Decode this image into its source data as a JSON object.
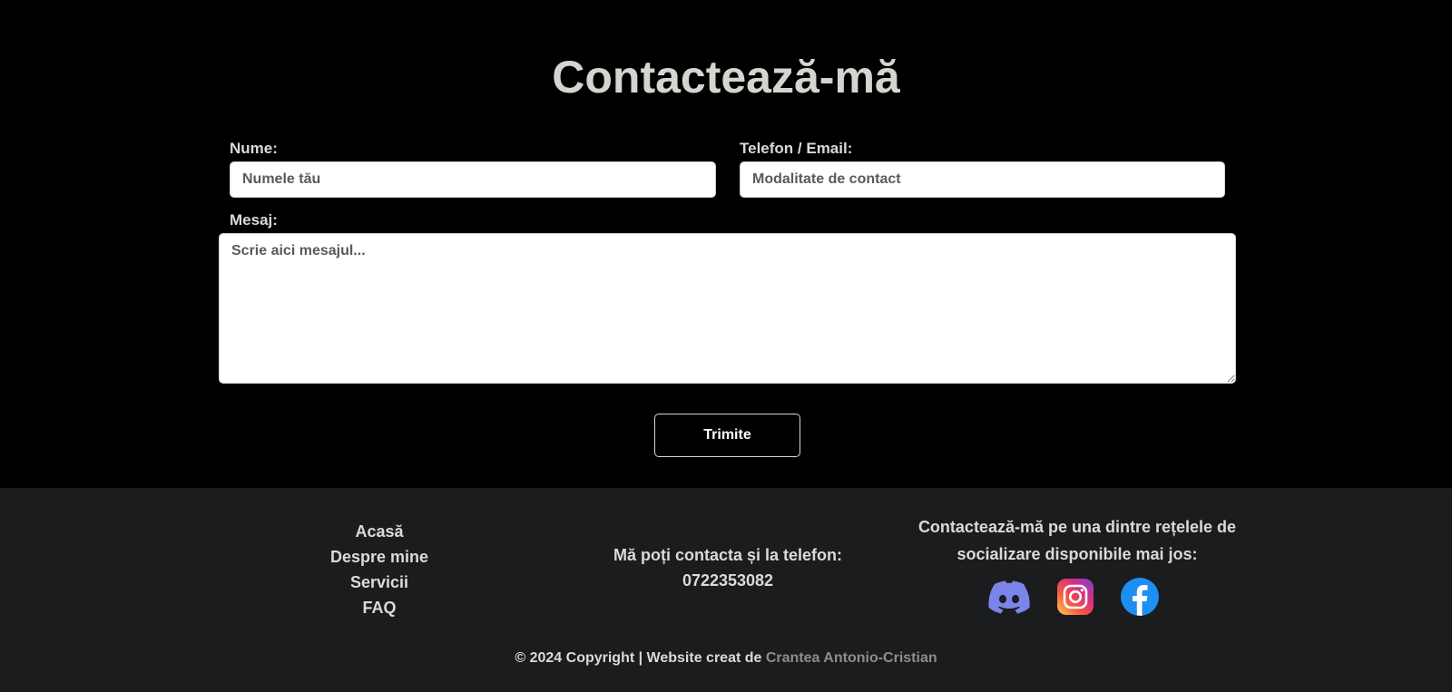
{
  "contact": {
    "title": "Contactează-mă",
    "name_label": "Nume:",
    "name_placeholder": "Numele tău",
    "contact_label": "Telefon / Email:",
    "contact_placeholder": "Modalitate de contact",
    "message_label": "Mesaj:",
    "message_placeholder": "Scrie aici mesajul...",
    "submit_label": "Trimite"
  },
  "footer": {
    "nav": [
      "Acasă",
      "Despre mine",
      "Servicii",
      "FAQ"
    ],
    "phone_text": "Mă poți contacta și la telefon:",
    "phone_number": "0722353082",
    "social_text_line1": "Contactează-mă pe una dintre rețelele de",
    "social_text_line2": "socializare disponibile mai jos:",
    "social_icons": [
      "discord-icon",
      "instagram-icon",
      "facebook-icon"
    ],
    "copyright_prefix": "© 2024 Copyright | Website creat de",
    "copyright_author": "Crantea Antonio-Cristian"
  },
  "colors": {
    "page_background": "#000000",
    "footer_background": "#1b1c1e",
    "text_light": "#dcdad5",
    "author_link": "#8d8d8d",
    "discord": "#7b84e8",
    "facebook": "#1e8ff2"
  }
}
